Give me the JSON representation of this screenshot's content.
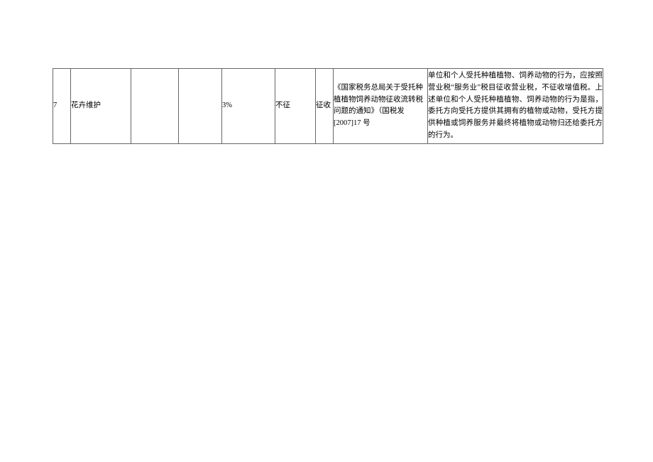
{
  "row": {
    "index": "7",
    "name": "花卉维护",
    "empty1": "",
    "empty2": "",
    "rate": "3%",
    "levy": "不征",
    "collect": "征收",
    "doc": "《国家税务总局关于受托种植植物饲养动物征收流转税问题的通知》（国税发[2007]17 号",
    "desc": "单位和个人受托种植植物、饲养动物的行为，应按照营业税“服务业”税目征收营业税，不征收增值税。上述单位和个人受托种植植物、饲养动物的行为是指，委托方向受托方提供其拥有的植物或动物，受托方提供种植或饲养服务并最终将植物或动物归还给委托方的行为。"
  }
}
